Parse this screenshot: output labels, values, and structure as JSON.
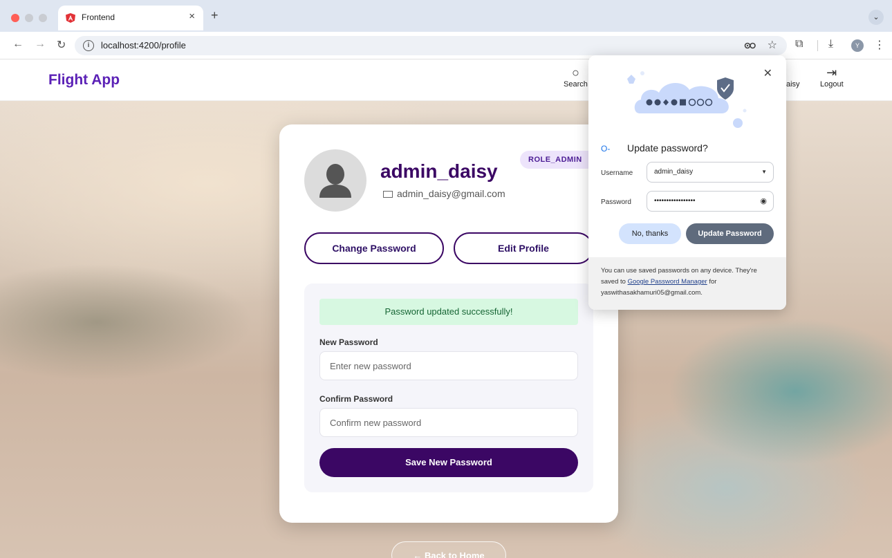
{
  "browser": {
    "tab_title": "Frontend",
    "tab_close": "×",
    "new_tab": "+",
    "url": "localhost:4200/profile"
  },
  "header": {
    "brand": "Flight App",
    "nav": {
      "search": "Search",
      "user": "aisy",
      "logout": "Logout"
    }
  },
  "profile": {
    "username": "admin_daisy",
    "email": "admin_daisy@gmail.com",
    "role": "ROLE_ADMIN",
    "change_password_label": "Change Password",
    "edit_profile_label": "Edit Profile",
    "success_message": "Password updated successfully!",
    "new_password_label": "New Password",
    "new_password_placeholder": "Enter new password",
    "confirm_password_label": "Confirm Password",
    "confirm_password_placeholder": "Confirm new password",
    "save_label": "Save New Password",
    "back_label": "← Back to Home"
  },
  "password_popup": {
    "title": "Update password?",
    "username_label": "Username",
    "username_value": "admin_daisy",
    "password_label": "Password",
    "password_value": "•••••••••••••••••",
    "no_thanks_label": "No, thanks",
    "update_label": "Update Password",
    "footer_text_1": "You can use saved passwords on any device. They're saved to ",
    "footer_link": "Google Password Manager",
    "footer_text_2": " for yaswithasakhamuri05@gmail.com."
  },
  "colors": {
    "brand": "#5b21b6",
    "primary": "#3b0764",
    "success_bg": "#d7f8e1",
    "success_text": "#166534",
    "badge_bg": "#ede4fb"
  }
}
